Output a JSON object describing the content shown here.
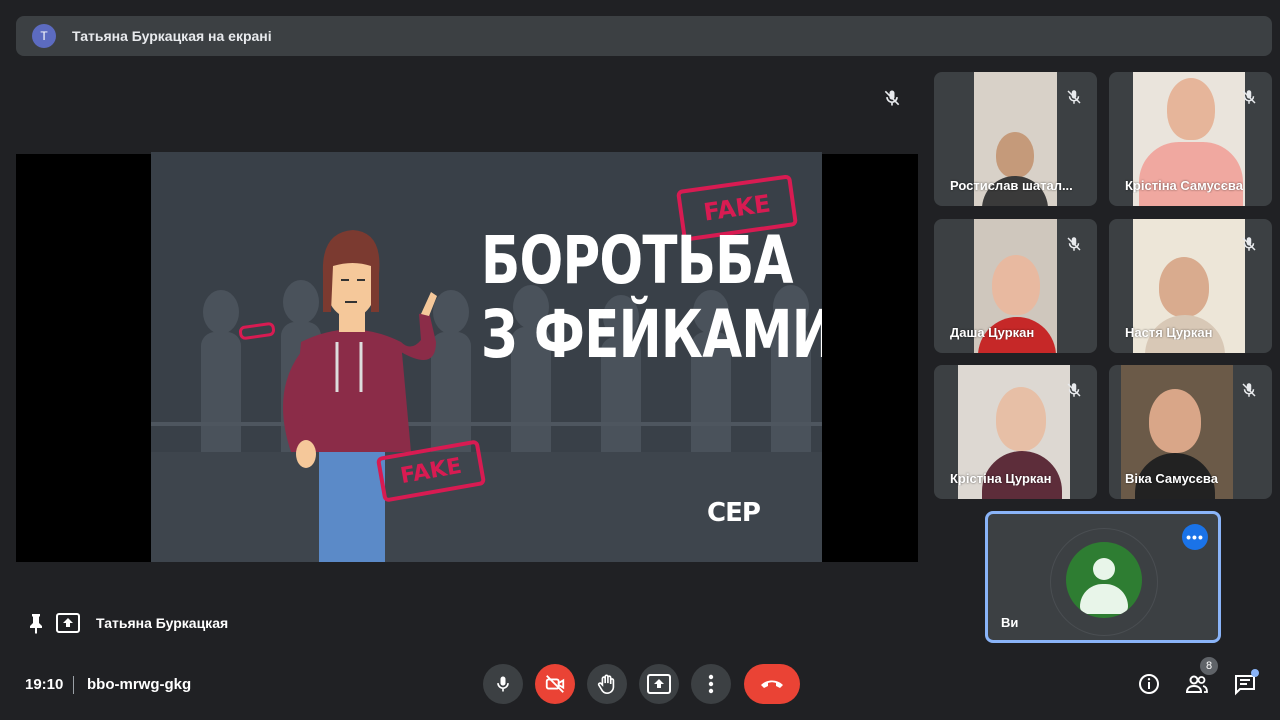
{
  "banner": {
    "avatar_letter": "Т",
    "text": "Татьяна Буркацкая на екрані"
  },
  "slide": {
    "title_line1": "БОРОТЬБА",
    "title_line2": "З ФЕЙКАМИ",
    "stamp_text": "FAKE",
    "logo_text": "CEP"
  },
  "presenter": {
    "name": "Татьяна Буркацкая"
  },
  "participants": [
    {
      "name": "Ростислав шатал..."
    },
    {
      "name": "Крістіна Самусєва"
    },
    {
      "name": "Даша Цуркан"
    },
    {
      "name": "Настя Цуркан"
    },
    {
      "name": "Крістіна Цуркан"
    },
    {
      "name": "Віка Самусєва"
    }
  ],
  "self": {
    "name": "Ви"
  },
  "bottom_bar": {
    "time": "19:10",
    "meeting_code": "bbo-mrwg-gkg",
    "people_count": "8"
  },
  "icons": {
    "mic": "microphone-icon",
    "camera_off": "camera-off-icon",
    "raise_hand": "hand-icon",
    "present": "present-screen-icon",
    "more": "more-vertical-icon",
    "end_call": "phone-hangup-icon",
    "info": "info-icon",
    "people": "people-icon",
    "chat": "chat-icon"
  },
  "colors": {
    "background": "#202124",
    "surface": "#3c4043",
    "danger": "#ea4335",
    "accent": "#8ab4f8",
    "stamp": "#d81b52"
  }
}
